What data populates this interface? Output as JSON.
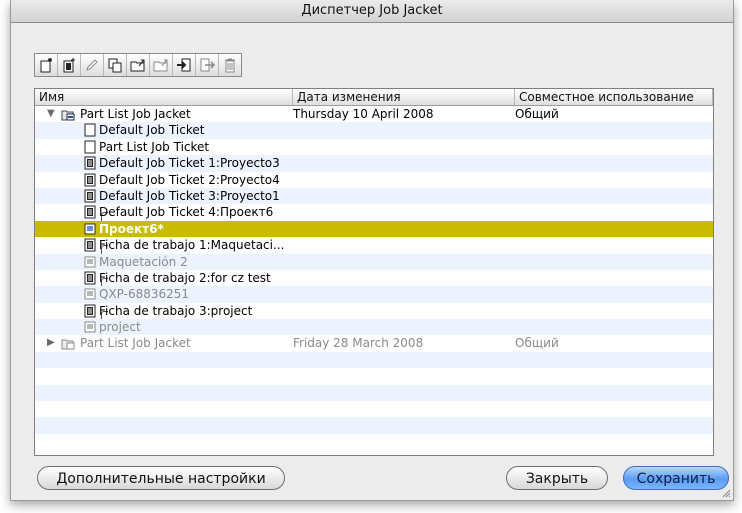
{
  "window": {
    "title": "Диспетчер Job Jacket"
  },
  "toolbar": {
    "buttons": [
      {
        "name": "new-job-jacket-icon"
      },
      {
        "name": "new-job-ticket-icon"
      },
      {
        "name": "edit-pencil-icon"
      },
      {
        "name": "duplicate-icon"
      },
      {
        "name": "open-folder-icon"
      },
      {
        "name": "open-folder-outline-icon"
      },
      {
        "name": "import-icon"
      },
      {
        "name": "export-icon"
      },
      {
        "name": "trash-icon"
      }
    ]
  },
  "columns": {
    "name": "Имя",
    "date": "Дата изменения",
    "share": "Совместное использование"
  },
  "rows": [
    {
      "name": "Part List Job Jacket",
      "date": "Thursday 10 April 2008",
      "share": "Общий"
    },
    {
      "name": "Default Job Ticket"
    },
    {
      "name": "Part List Job Ticket"
    },
    {
      "name": "Default Job Ticket 1:Proyecto3"
    },
    {
      "name": "Default Job Ticket 2:Proyecto4"
    },
    {
      "name": "Default Job Ticket 3:Proyecto1"
    },
    {
      "name": "Default Job Ticket 4:Проект6"
    },
    {
      "name": "Проект6*"
    },
    {
      "name": "Ficha de trabajo 1:Maquetaci..."
    },
    {
      "name": "Maquetación 2"
    },
    {
      "name": "Ficha de trabajo 2:for cz test"
    },
    {
      "name": "QXP-68836251"
    },
    {
      "name": "Ficha de trabajo 3:project"
    },
    {
      "name": "project"
    },
    {
      "name": "Part List Job Jacket",
      "date": "Friday 28 March 2008",
      "share": "Общий"
    }
  ],
  "buttons": {
    "advanced": "Дополнительные настройки",
    "close": "Закрыть",
    "save": "Сохранить"
  },
  "colors": {
    "selection": "#c9bb00",
    "row_alt": "#edf3fe",
    "default_button": "#5a9cf0"
  }
}
